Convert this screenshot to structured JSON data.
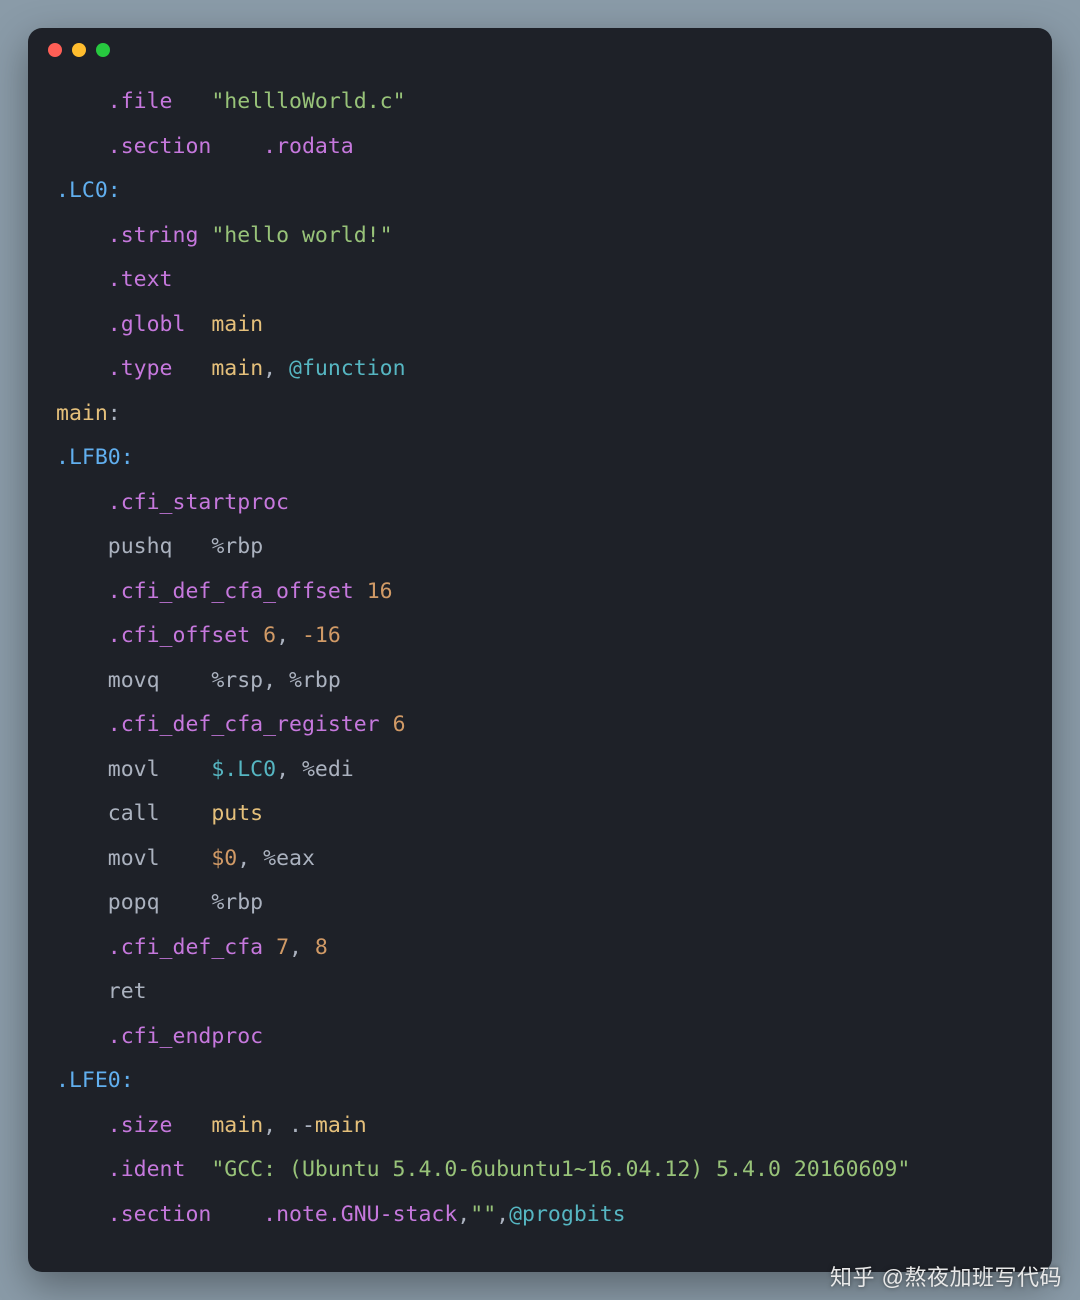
{
  "titlebar": {
    "dots": [
      "close",
      "minimize",
      "zoom"
    ]
  },
  "code": {
    "lines": [
      [
        [
          "pl",
          "    "
        ],
        [
          "k",
          ".file"
        ],
        [
          "pl",
          "   "
        ],
        [
          "s",
          "\"hellloWorld.c\""
        ]
      ],
      [
        [
          "pl",
          "    "
        ],
        [
          "k",
          ".section"
        ],
        [
          "pl",
          "    "
        ],
        [
          "k",
          ".rodata"
        ]
      ],
      [
        [
          "lbl",
          ".LC0:"
        ]
      ],
      [
        [
          "pl",
          "    "
        ],
        [
          "k",
          ".string"
        ],
        [
          "pl",
          " "
        ],
        [
          "s",
          "\"hello world!\""
        ]
      ],
      [
        [
          "pl",
          "    "
        ],
        [
          "k",
          ".text"
        ]
      ],
      [
        [
          "pl",
          "    "
        ],
        [
          "k",
          ".globl"
        ],
        [
          "pl",
          "  "
        ],
        [
          "id",
          "main"
        ]
      ],
      [
        [
          "pl",
          "    "
        ],
        [
          "k",
          ".type"
        ],
        [
          "pl",
          "   "
        ],
        [
          "id",
          "main"
        ],
        [
          "pl",
          ", "
        ],
        [
          "op",
          "@function"
        ]
      ],
      [
        [
          "id",
          "main"
        ],
        [
          "pl",
          ":"
        ]
      ],
      [
        [
          "lbl",
          ".LFB0:"
        ]
      ],
      [
        [
          "pl",
          "    "
        ],
        [
          "k",
          ".cfi_startproc"
        ]
      ],
      [
        [
          "pl",
          "    "
        ],
        [
          "mn",
          "pushq"
        ],
        [
          "pl",
          "   "
        ],
        [
          "reg",
          "%rbp"
        ]
      ],
      [
        [
          "pl",
          "    "
        ],
        [
          "k",
          ".cfi_def_cfa_offset"
        ],
        [
          "pl",
          " "
        ],
        [
          "num",
          "16"
        ]
      ],
      [
        [
          "pl",
          "    "
        ],
        [
          "k",
          ".cfi_offset"
        ],
        [
          "pl",
          " "
        ],
        [
          "num",
          "6"
        ],
        [
          "pl",
          ", "
        ],
        [
          "num",
          "-16"
        ]
      ],
      [
        [
          "pl",
          "    "
        ],
        [
          "mn",
          "movq"
        ],
        [
          "pl",
          "    "
        ],
        [
          "reg",
          "%rsp"
        ],
        [
          "pl",
          ", "
        ],
        [
          "reg",
          "%rbp"
        ]
      ],
      [
        [
          "pl",
          "    "
        ],
        [
          "k",
          ".cfi_def_cfa_register"
        ],
        [
          "pl",
          " "
        ],
        [
          "num",
          "6"
        ]
      ],
      [
        [
          "pl",
          "    "
        ],
        [
          "mn",
          "movl"
        ],
        [
          "pl",
          "    "
        ],
        [
          "op",
          "$.LC0"
        ],
        [
          "pl",
          ", "
        ],
        [
          "reg",
          "%edi"
        ]
      ],
      [
        [
          "pl",
          "    "
        ],
        [
          "mn",
          "call"
        ],
        [
          "pl",
          "    "
        ],
        [
          "id",
          "puts"
        ]
      ],
      [
        [
          "pl",
          "    "
        ],
        [
          "mn",
          "movl"
        ],
        [
          "pl",
          "    "
        ],
        [
          "num",
          "$0"
        ],
        [
          "pl",
          ", "
        ],
        [
          "reg",
          "%eax"
        ]
      ],
      [
        [
          "pl",
          "    "
        ],
        [
          "mn",
          "popq"
        ],
        [
          "pl",
          "    "
        ],
        [
          "reg",
          "%rbp"
        ]
      ],
      [
        [
          "pl",
          "    "
        ],
        [
          "k",
          ".cfi_def_cfa"
        ],
        [
          "pl",
          " "
        ],
        [
          "num",
          "7"
        ],
        [
          "pl",
          ", "
        ],
        [
          "num",
          "8"
        ]
      ],
      [
        [
          "pl",
          "    "
        ],
        [
          "mn",
          "ret"
        ]
      ],
      [
        [
          "pl",
          "    "
        ],
        [
          "k",
          ".cfi_endproc"
        ]
      ],
      [
        [
          "lbl",
          ".LFE0:"
        ]
      ],
      [
        [
          "pl",
          "    "
        ],
        [
          "k",
          ".size"
        ],
        [
          "pl",
          "   "
        ],
        [
          "id",
          "main"
        ],
        [
          "pl",
          ", .-"
        ],
        [
          "id",
          "main"
        ]
      ],
      [
        [
          "pl",
          "    "
        ],
        [
          "k",
          ".ident"
        ],
        [
          "pl",
          "  "
        ],
        [
          "s",
          "\"GCC: (Ubuntu 5.4.0-6ubuntu1~16.04.12) 5.4.0 20160609\""
        ]
      ],
      [
        [
          "pl",
          "    "
        ],
        [
          "k",
          ".section"
        ],
        [
          "pl",
          "    "
        ],
        [
          "k",
          ".note.GNU-stack"
        ],
        [
          "pl",
          ","
        ],
        [
          "s",
          "\"\""
        ],
        [
          "pl",
          ","
        ],
        [
          "op",
          "@progbits"
        ]
      ]
    ]
  },
  "watermark": "知乎 @熬夜加班写代码"
}
